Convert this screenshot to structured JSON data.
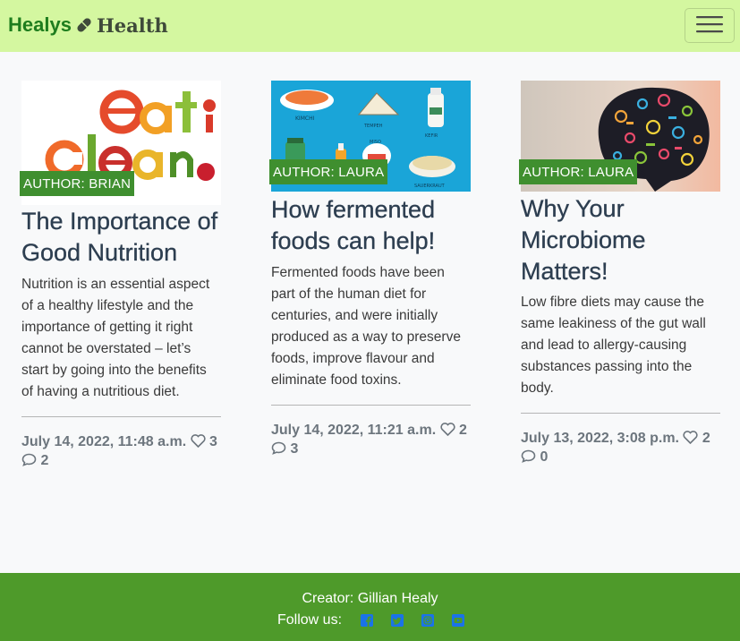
{
  "navbar": {
    "brand_part1": "Healys",
    "brand_part2": "Health",
    "pill_icon": "pill-icon",
    "toggle_icon": "hamburger-menu-icon"
  },
  "posts": [
    {
      "author": "AUTHOR: BRIAN",
      "title": "The Importance of Good Nutrition",
      "excerpt": "Nutrition is an essential aspect of a healthy lifestyle and the importance of getting it right cannot be overstated – let’s start by going into the benefits of having a nutritious diet.",
      "date": "July 14, 2022, 11:48 a.m.",
      "likes": "3",
      "comments": "2",
      "image_alt": "eat clean vegetables"
    },
    {
      "author": "AUTHOR: LAURA",
      "title": "How fermented foods can help!",
      "excerpt": "Fermented foods have been part of the human diet for centuries, and were initially produced as a way to preserve foods, improve flavour and eliminate food toxins.",
      "date": "July 14, 2022, 11:21 a.m.",
      "likes": "2",
      "comments": "3",
      "image_alt": "fermented foods illustration",
      "image_labels": [
        "KIMCHI",
        "TEMPEH",
        "KEFIR",
        "MISO",
        "SAUERKRAUT"
      ]
    },
    {
      "author": "AUTHOR: LAURA",
      "title": "Why Your Microbiome Matters!",
      "excerpt": "Low fibre diets may cause the same leakiness of the gut wall and lead to allergy-causing substances passing into the body.",
      "date": "July 13, 2022, 3:08 p.m.",
      "likes": "2",
      "comments": "0",
      "image_alt": "brain microbiome icons"
    }
  ],
  "footer": {
    "creator": "Creator: Gillian Healy",
    "follow_label": "Follow us:",
    "social_icons": [
      "facebook-icon",
      "twitter-icon",
      "instagram-icon",
      "youtube-icon"
    ]
  },
  "colors": {
    "navbar_bg": "#d4f7a0",
    "brand_green": "#1e7d1e",
    "author_badge": "#3f8f2f",
    "footer_bg": "#4e9a2a",
    "social_icon": "#1a73e8"
  }
}
